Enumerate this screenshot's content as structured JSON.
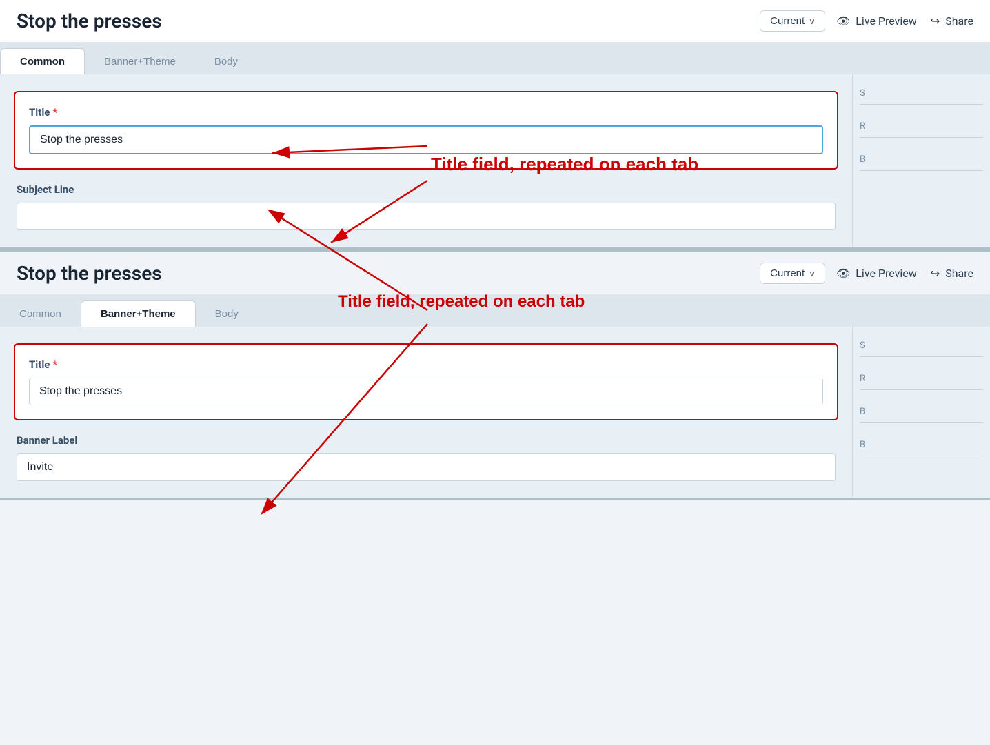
{
  "app": {
    "title": "Stop the presses"
  },
  "panel1": {
    "title": "Stop the presses",
    "version_label": "Current",
    "live_preview_label": "Live Preview",
    "share_label": "Share",
    "tabs": [
      {
        "id": "common",
        "label": "Common",
        "active": true
      },
      {
        "id": "banner_theme",
        "label": "Banner+Theme",
        "active": false
      },
      {
        "id": "body",
        "label": "Body",
        "active": false
      }
    ],
    "title_field": {
      "label": "Title",
      "required": true,
      "value": "Stop the presses",
      "focused": true
    },
    "subject_line_field": {
      "label": "Subject Line",
      "value": "",
      "placeholder": ""
    }
  },
  "panel2": {
    "title": "Stop the presses",
    "version_label": "Current",
    "live_preview_label": "Live Preview",
    "share_label": "Share",
    "tabs": [
      {
        "id": "common",
        "label": "Common",
        "active": false
      },
      {
        "id": "banner_theme",
        "label": "Banner+Theme",
        "active": true
      },
      {
        "id": "body",
        "label": "Body",
        "active": false
      }
    ],
    "title_field": {
      "label": "Title",
      "required": true,
      "value": "Stop the presses"
    },
    "banner_label_field": {
      "label": "Banner Label",
      "value": "Invite"
    }
  },
  "annotation": {
    "text": "Title field, repeated on each tab",
    "color": "#cc0000"
  },
  "sidebar_items": [
    "S",
    "R",
    "B",
    "B",
    "B"
  ]
}
